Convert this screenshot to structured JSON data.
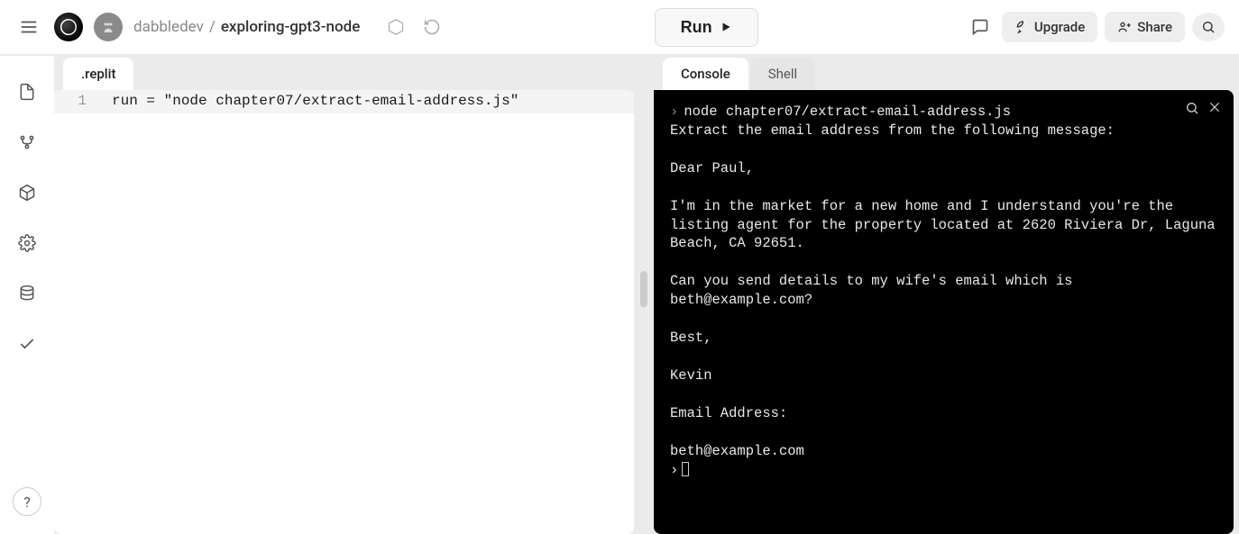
{
  "header": {
    "owner": "dabbledev",
    "separator": "/",
    "project": "exploring-gpt3-node",
    "run_label": "Run",
    "upgrade_label": "Upgrade",
    "share_label": "Share"
  },
  "sidebar": {
    "help_label": "?"
  },
  "editor": {
    "tab_label": ".replit",
    "line_number": "1",
    "code_key": "run",
    "code_op": " = ",
    "code_str": "\"node chapter07/extract-email-address.js\""
  },
  "console_panel": {
    "tab_console": "Console",
    "tab_shell": "Shell",
    "command": "node chapter07/extract-email-address.js",
    "output": "Extract the email address from the following message:\n\nDear Paul,\n\nI'm in the market for a new home and I understand you're the listing agent for the property located at 2620 Riviera Dr, Laguna Beach, CA 92651.\n\nCan you send details to my wife's email which is beth@example.com?\n\nBest,\n\nKevin\n\nEmail Address:\n\nbeth@example.com",
    "prompt_char": "›"
  }
}
